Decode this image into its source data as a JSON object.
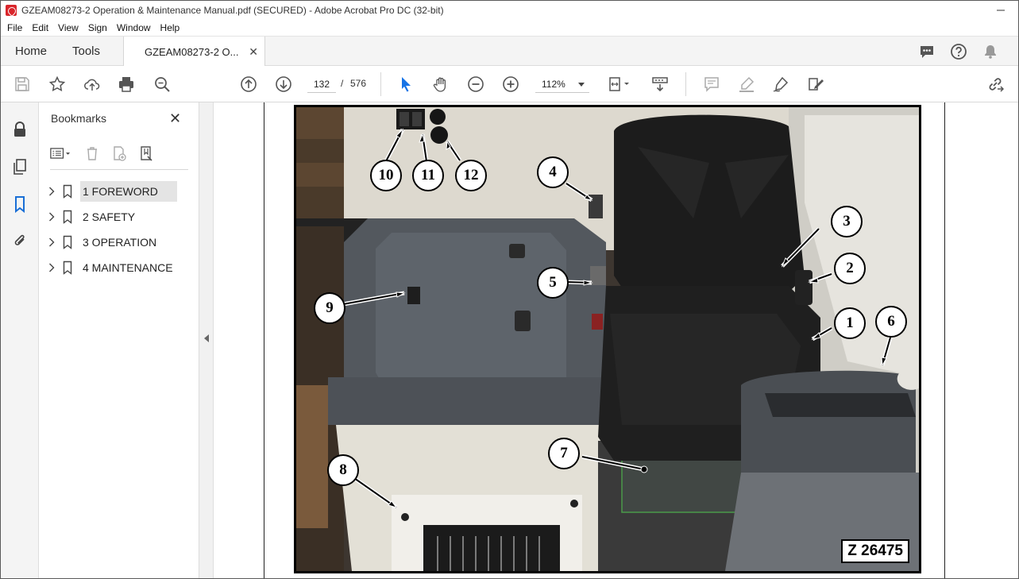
{
  "window": {
    "title": "GZEAM08273-2 Operation & Maintenance Manual.pdf (SECURED) - Adobe Acrobat Pro DC (32-bit)"
  },
  "menu": [
    "File",
    "Edit",
    "View",
    "Sign",
    "Window",
    "Help"
  ],
  "tabs": {
    "home": "Home",
    "tools": "Tools",
    "document": "GZEAM08273-2 O..."
  },
  "toolbar": {
    "current_page": "132",
    "page_separator": "/",
    "total_pages": "576",
    "zoom": "112%"
  },
  "bookmarks": {
    "title": "Bookmarks",
    "items": [
      {
        "label": "1 FOREWORD",
        "selected": true
      },
      {
        "label": "2 SAFETY",
        "selected": false
      },
      {
        "label": "3 OPERATION",
        "selected": false
      },
      {
        "label": "4 MAINTENANCE",
        "selected": false
      }
    ]
  },
  "figure": {
    "callouts": [
      "1",
      "2",
      "3",
      "4",
      "5",
      "6",
      "7",
      "8",
      "9",
      "10",
      "11",
      "12"
    ],
    "code": "Z 26475"
  }
}
